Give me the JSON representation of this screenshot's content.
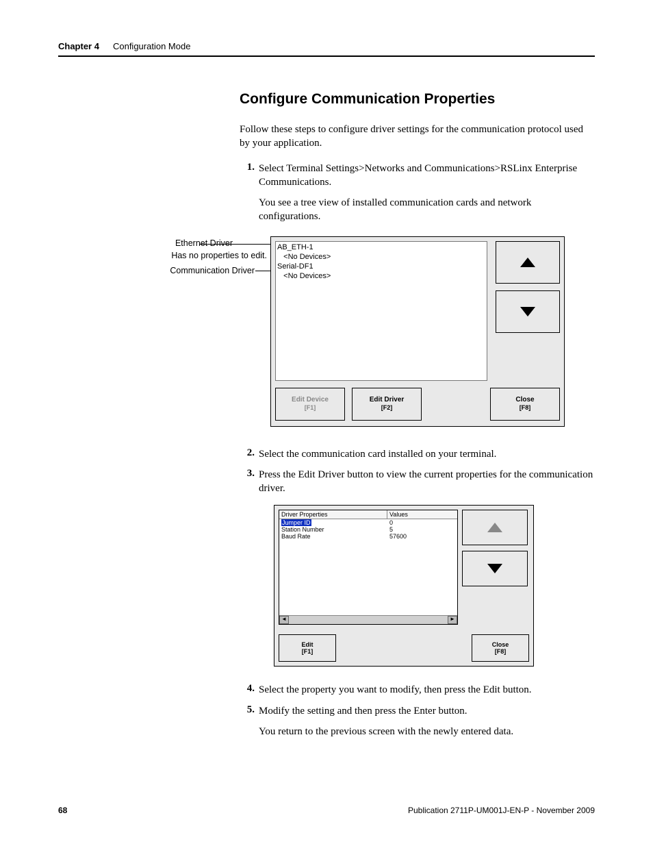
{
  "header": {
    "chapter": "Chapter 4",
    "title": "Configuration Mode"
  },
  "section": {
    "title": "Configure Communication Properties",
    "intro": "Follow these steps to configure driver settings for the communication protocol used by your application."
  },
  "steps": {
    "1": {
      "num": "1.",
      "text": "Select Terminal Settings>Networks and Communications>RSLinx Enterprise Communications.",
      "follow": "You see a tree view of installed communication cards and network configurations."
    },
    "2": {
      "num": "2.",
      "text": "Select the communication card installed on your terminal."
    },
    "3": {
      "num": "3.",
      "text": "Press the Edit Driver button to view the current properties for the communication driver."
    },
    "4": {
      "num": "4.",
      "text": "Select the property you want to modify, then press the Edit button."
    },
    "5": {
      "num": "5.",
      "text": "Modify the setting and then press the Enter button."
    },
    "closing": "You return to the previous screen with the newly entered data."
  },
  "fig1": {
    "callouts": {
      "ethernet": "Ethernet Driver",
      "noprops": "Has no properties to edit.",
      "commdriver": "Communication Driver"
    },
    "tree": {
      "l1": "AB_ETH-1",
      "l2": "   <No Devices>",
      "l3": "Serial-DF1",
      "l4": "   <No Devices>"
    },
    "buttons": {
      "edit_device": "Edit Device",
      "edit_device_key": "[F1]",
      "edit_driver": "Edit Driver",
      "edit_driver_key": "[F2]",
      "close": "Close",
      "close_key": "[F8]"
    }
  },
  "fig2": {
    "headers": {
      "left": "Driver Properties",
      "right": "Values"
    },
    "rows": {
      "0": {
        "name": "Jumper ID",
        "value": "0"
      },
      "1": {
        "name": "Station Number",
        "value": "5"
      },
      "2": {
        "name": "Baud Rate",
        "value": "57600"
      }
    },
    "buttons": {
      "edit": "Edit",
      "edit_key": "[F1]",
      "close": "Close",
      "close_key": "[F8]"
    }
  },
  "footer": {
    "page": "68",
    "pub": "Publication 2711P-UM001J-EN-P - November 2009"
  }
}
